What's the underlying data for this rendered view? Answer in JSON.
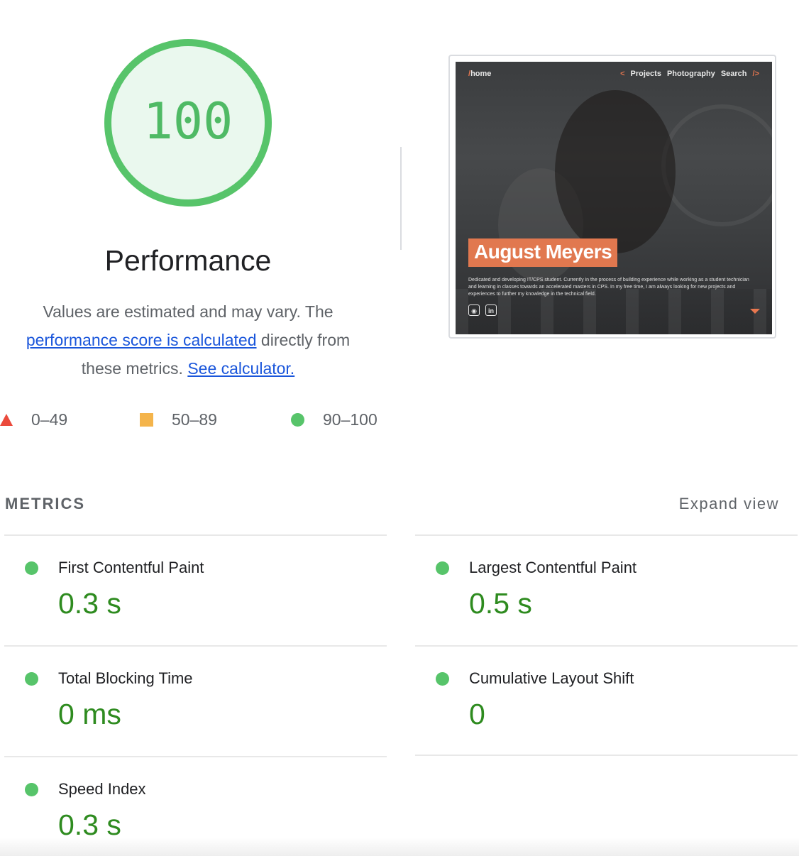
{
  "gauge": {
    "score": "100",
    "color": "#4fba65",
    "fill_color": "#eaf8ee"
  },
  "category": {
    "title": "Performance"
  },
  "description": {
    "text_before": "Values are estimated and may vary. The ",
    "link_score": "performance score is calculated",
    "text_middle": " directly from these metrics. ",
    "link_calculator": "See calculator."
  },
  "legend": [
    {
      "range": "0–49",
      "shape": "triangle",
      "color": "#eb4a3c"
    },
    {
      "range": "50–89",
      "shape": "square",
      "color": "#f4b44b"
    },
    {
      "range": "90–100",
      "shape": "circle",
      "color": "#57c46a"
    }
  ],
  "screenshot": {
    "nav_home_slash": "/",
    "nav_home": "home",
    "nav_open": "<",
    "nav_items": [
      "Projects",
      "Photography",
      "Search"
    ],
    "nav_close": "/>",
    "name": "August Meyers",
    "bio": "Dedicated and developing IT/CPS student. Currently in the process of building experience while working as a student technician and learning in classes towards an accelerated masters in CPS. In my free time, I am always looking for new projects and experiences to further my knowledge in the technical field.",
    "icons": [
      "github-icon",
      "linkedin-icon"
    ],
    "accent_color": "#e1784f"
  },
  "metrics": {
    "heading": "METRICS",
    "expand_label": "Expand view",
    "items": [
      {
        "title": "First Contentful Paint",
        "value": "0.3 s",
        "status": "pass"
      },
      {
        "title": "Largest Contentful Paint",
        "value": "0.5 s",
        "status": "pass"
      },
      {
        "title": "Total Blocking Time",
        "value": "0 ms",
        "status": "pass"
      },
      {
        "title": "Cumulative Layout Shift",
        "value": "0",
        "status": "pass"
      },
      {
        "title": "Speed Index",
        "value": "0.3 s",
        "status": "pass"
      }
    ],
    "pass_color": "#2e8b1f"
  }
}
